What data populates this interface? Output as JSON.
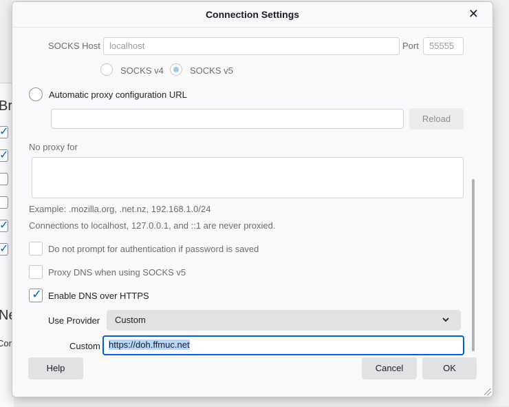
{
  "background": {
    "heading_fragment": "Bro",
    "heading_fragment_2": "Ne",
    "text_fragment": "Con",
    "checkboxes": [
      true,
      true,
      false,
      false,
      true,
      true
    ]
  },
  "dialog": {
    "title": "Connection Settings",
    "socks": {
      "host_label": "SOCKS Host",
      "host_value": "localhost",
      "port_label": "Port",
      "port_value": "55555",
      "v4_label": "SOCKS v4",
      "v5_label": "SOCKS v5",
      "selected": "SOCKS v5"
    },
    "auto_proxy": {
      "label": "Automatic proxy configuration URL",
      "url_value": "",
      "reload_label": "Reload"
    },
    "no_proxy": {
      "label": "No proxy for",
      "value": "",
      "example": "Example: .mozilla.org, .net.nz, 192.168.1.0/24",
      "note": "Connections to localhost, 127.0.0.1, and ::1 are never proxied."
    },
    "options": [
      {
        "label": "Do not prompt for authentication if password is saved",
        "checked": false
      },
      {
        "label": "Proxy DNS when using SOCKS v5",
        "checked": false
      },
      {
        "label": "Enable DNS over HTTPS",
        "checked": true
      }
    ],
    "dns": {
      "provider_label": "Use Provider",
      "provider_value": "Custom",
      "custom_label": "Custom",
      "custom_value": "https://doh.ffmuc.net"
    },
    "buttons": {
      "help": "Help",
      "cancel": "Cancel",
      "ok": "OK"
    }
  },
  "icons": {
    "close": "close-icon",
    "chevron": "chevron-down-icon"
  },
  "colors": {
    "accent": "#0060df",
    "selection": "#b3d7ff"
  }
}
